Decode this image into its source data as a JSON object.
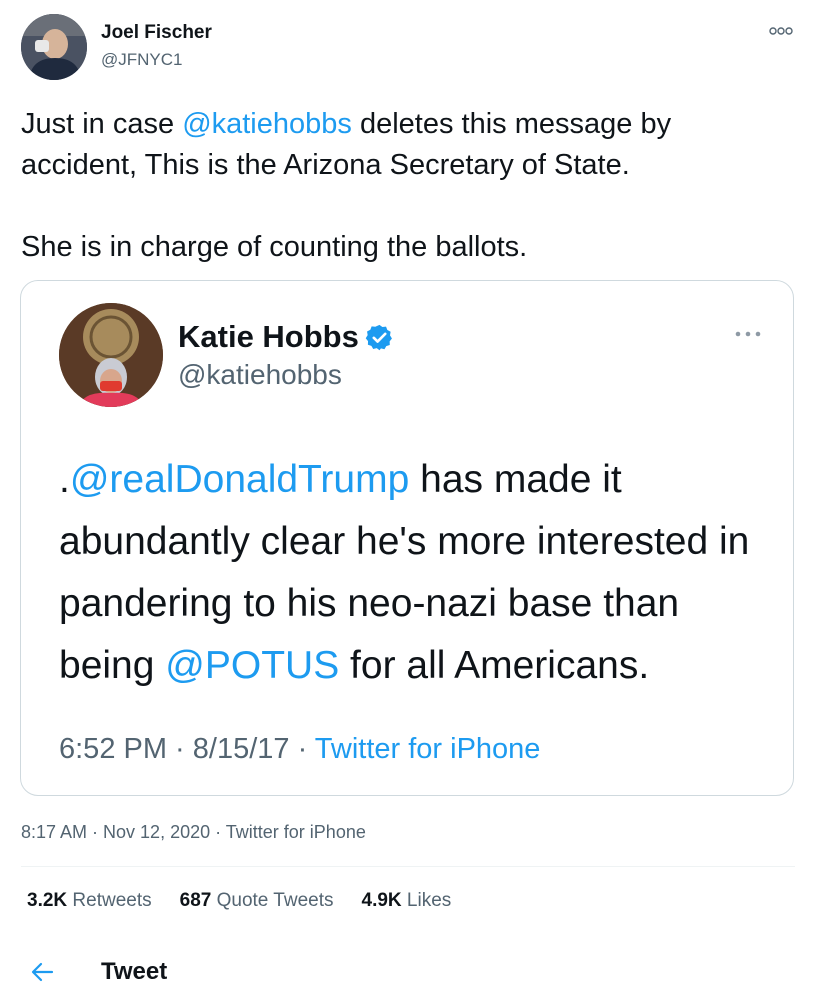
{
  "author": {
    "name": "Joel Fischer",
    "handle": "@JFNYC1"
  },
  "tweet": {
    "line1_prefix": "Just in case ",
    "line1_mention": "@katiehobbs",
    "line1_suffix": " deletes this message by",
    "line2": "accident, This is the Arizona Secretary of State.",
    "line3": "She is in charge of counting the ballots."
  },
  "quoted": {
    "name": "Katie Hobbs",
    "handle": "@katiehobbs",
    "text_prefix": ".",
    "mention1": "@realDonaldTrump",
    "text_mid": " has made it abundantly clear he's more interested in pandering to his neo-nazi base than being ",
    "mention2": "@POTUS",
    "text_suffix": " for all Americans.",
    "time": "6:52 PM · 8/15/17 · ",
    "source": "Twitter for iPhone"
  },
  "meta": {
    "time": "8:17 AM · Nov 12, 2020 · Twitter for iPhone"
  },
  "stats": {
    "retweets_count": "3.2K",
    "retweets_label": " Retweets",
    "quotes_count": "687",
    "quotes_label": " Quote Tweets",
    "likes_count": "4.9K",
    "likes_label": " Likes"
  },
  "header": {
    "title": "Tweet"
  },
  "colors": {
    "accent": "#1d9bf0",
    "secondary_text": "#536471",
    "border": "#cfd9de"
  },
  "icons": {
    "more": "more-icon",
    "verified": "verified-badge-icon",
    "back": "back-arrow-icon"
  }
}
